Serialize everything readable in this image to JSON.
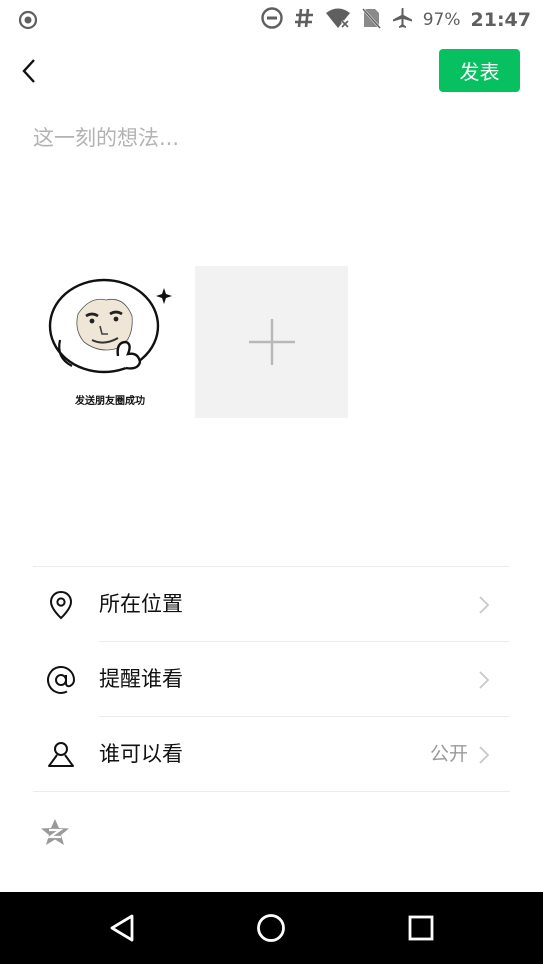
{
  "status_bar": {
    "battery": "97%",
    "time": "21:47",
    "icons": [
      "record-icon",
      "dnd-icon",
      "hash-icon",
      "wifi-off-icon",
      "no-sim-icon",
      "airplane-icon"
    ]
  },
  "header": {
    "publish_label": "发表"
  },
  "composer": {
    "placeholder": "这一刻的想法..."
  },
  "photos": {
    "items": [
      {
        "caption": "发送朋友圈成功",
        "icon": "meme-face-image"
      }
    ],
    "add_icon": "plus-icon"
  },
  "menu": {
    "items": [
      {
        "label": "所在位置",
        "icon": "location-pin-icon",
        "value": ""
      },
      {
        "label": "提醒谁看",
        "icon": "at-icon",
        "value": ""
      },
      {
        "label": "谁可以看",
        "icon": "person-icon",
        "value": "公开"
      }
    ],
    "extra_icon": "qzone-star-icon"
  },
  "nav_bar": {
    "icons": [
      "back-triangle-icon",
      "home-circle-icon",
      "recents-square-icon"
    ]
  },
  "colors": {
    "accent": "#07c160",
    "placeholder": "#b3b3b3",
    "secondary_text": "#9a9a9a"
  }
}
